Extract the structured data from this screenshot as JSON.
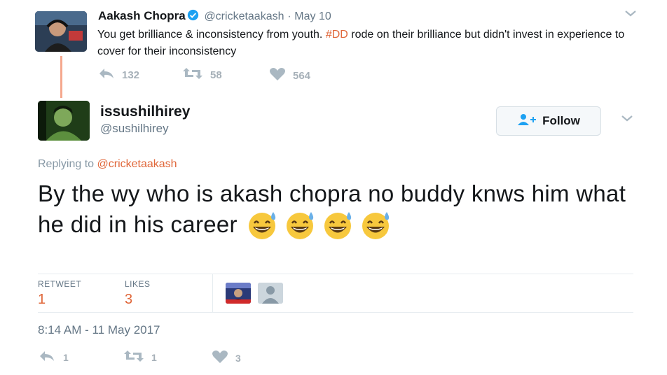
{
  "parent_tweet": {
    "author_name": "Aakash Chopra",
    "author_handle": "@cricketaakash",
    "separator": "·",
    "date": "May 10",
    "text_before_hashtag": "You get brilliance & inconsistency from youth. ",
    "hashtag": "#DD",
    "text_after_hashtag": " rode on their brilliance but didn't invest in experience to cover for their inconsistency",
    "reply_count": "132",
    "retweet_count": "58",
    "like_count": "564"
  },
  "main_tweet": {
    "display_name": "issushilhirey",
    "screen_name": "@sushilhirey",
    "follow_label": "Follow",
    "replying_prefix": "Replying to ",
    "replying_mention": "@cricketaakash",
    "text": "By the wy who is akash chopra no buddy knws him what he did in his career ",
    "emoji_name": "grinning-face-with-sweat-emoji",
    "emoji_count": 4,
    "stats": {
      "retweet_label": "RETWEET",
      "retweet_value": "1",
      "likes_label": "LIKES",
      "likes_value": "3"
    },
    "timestamp": "8:14 AM - 11 May 2017",
    "reply_count": "1",
    "retweet_count": "1",
    "like_count": "3"
  },
  "colors": {
    "accent": "#e0673a",
    "verified": "#1da1f2",
    "muted": "#657786",
    "thread_line": "#f5a88e"
  }
}
